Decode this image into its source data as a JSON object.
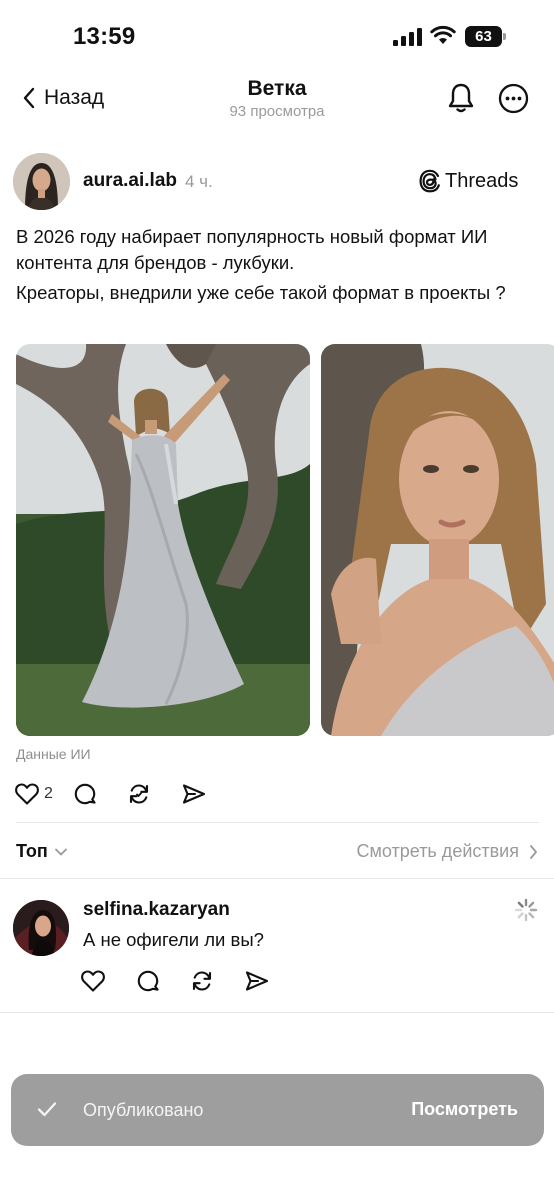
{
  "status_bar": {
    "time": "13:59",
    "battery_level": "63",
    "icons": [
      "signal-icon",
      "wifi-icon",
      "battery-icon"
    ]
  },
  "header": {
    "back_label": "Назад",
    "title": "Ветка",
    "subtitle": "93 просмотра",
    "icons": [
      "chevron-left-icon",
      "bell-icon",
      "more-icon"
    ]
  },
  "post": {
    "author": "aura.ai.lab",
    "time": "4 ч.",
    "source_label": "Threads",
    "text_lines": [
      "В 2026 году набирает популярность новый формат ИИ контента для брендов - лукбуки.",
      "Креаторы, внедрили уже себе такой формат в проекты ?"
    ],
    "ai_label": "Данные ИИ",
    "like_count": "2",
    "action_icons": [
      "heart-icon",
      "comment-icon",
      "repost-icon",
      "share-icon"
    ]
  },
  "replies_header": {
    "sort_label": "Топ",
    "view_activity_label": "Смотреть действия"
  },
  "reply": {
    "author": "selfina.kazaryan",
    "text": "А не офигели ли вы?"
  },
  "toast": {
    "message": "Опубликовано",
    "action_label": "Посмотреть"
  },
  "colors": {
    "text_primary": "#111111",
    "text_secondary": "#9a9a9a",
    "toast_bg": "#9e9e9e",
    "divider": "#e6e6e6"
  }
}
